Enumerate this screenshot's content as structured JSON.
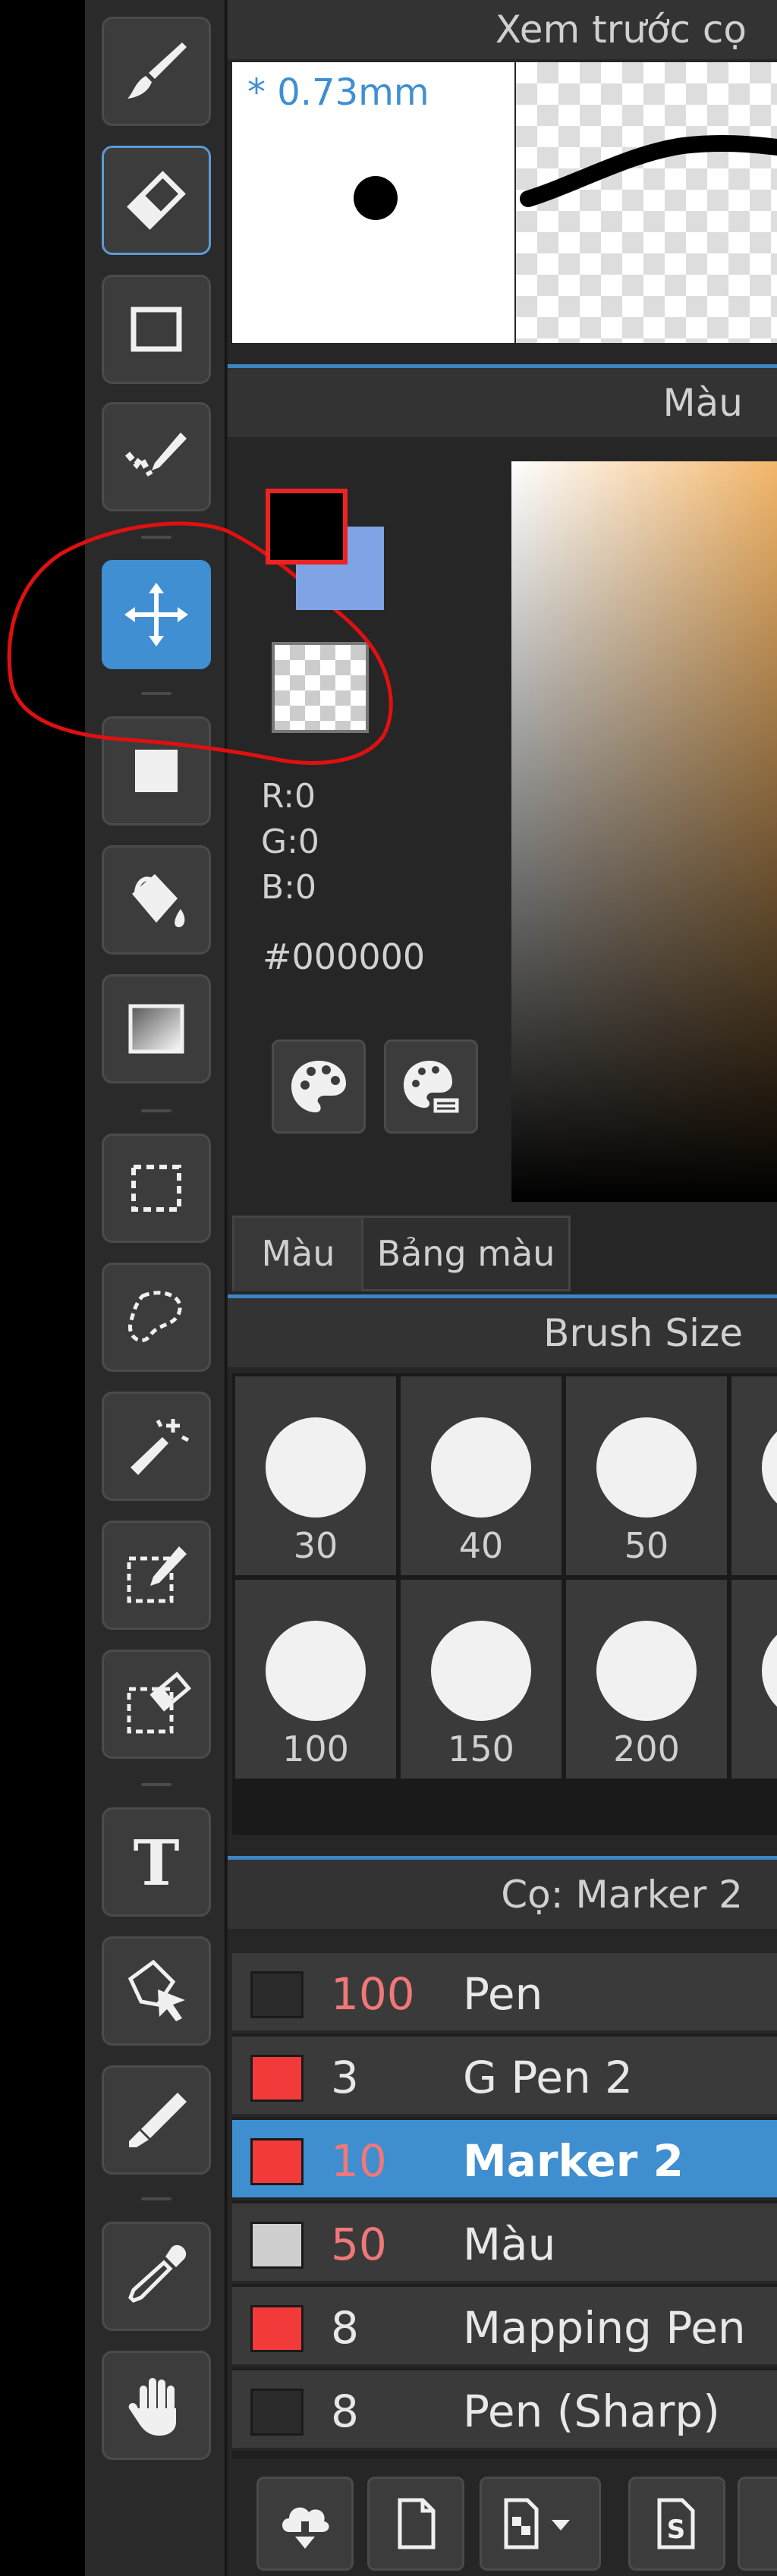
{
  "tools": [
    {
      "name": "brush-tool",
      "icon": "brush-icon"
    },
    {
      "name": "eraser-tool",
      "icon": "eraser-icon",
      "state": "outlined"
    },
    {
      "name": "shape-tool",
      "icon": "rectangle-icon"
    },
    {
      "name": "correction-tool",
      "icon": "check-pen-icon"
    },
    {
      "name": "move-tool",
      "icon": "move-arrows-icon",
      "state": "active"
    },
    {
      "name": "fill-rect-tool",
      "icon": "filled-square-icon"
    },
    {
      "name": "bucket-tool",
      "icon": "paint-bucket-icon"
    },
    {
      "name": "gradient-tool",
      "icon": "gradient-icon"
    },
    {
      "name": "rect-select-tool",
      "icon": "dashed-rectangle-icon"
    },
    {
      "name": "lasso-tool",
      "icon": "lasso-icon"
    },
    {
      "name": "magic-wand-tool",
      "icon": "magic-wand-icon"
    },
    {
      "name": "select-pen-tool",
      "icon": "select-pen-icon"
    },
    {
      "name": "select-eraser-tool",
      "icon": "select-eraser-icon"
    },
    {
      "name": "text-tool",
      "icon": "text-t-icon"
    },
    {
      "name": "operation-tool",
      "icon": "pointer-select-icon"
    },
    {
      "name": "divide-tool",
      "icon": "cutter-icon"
    },
    {
      "name": "eyedropper-tool",
      "icon": "eyedropper-icon"
    },
    {
      "name": "hand-tool",
      "icon": "hand-icon"
    }
  ],
  "brush_preview": {
    "title": "Xem trước cọ",
    "size_label": "* 0.73mm"
  },
  "color_panel": {
    "title": "Màu",
    "foreground": "#000000",
    "background": "#7fa4e6",
    "rgb": {
      "r": "R:0",
      "g": "G:0",
      "b": "B:0"
    },
    "hex": "#000000",
    "gradient_color": "#f3b66a"
  },
  "color_tabs": [
    {
      "label": "Màu",
      "active": true
    },
    {
      "label": "Bảng màu",
      "active": false
    }
  ],
  "brush_size": {
    "title": "Brush Size",
    "sizes": [
      "30",
      "40",
      "50",
      "100",
      "150",
      "200"
    ]
  },
  "brush_list": {
    "title": "Cọ: Marker 2",
    "items": [
      {
        "size": "100",
        "name": "Pen",
        "swatch": "#2a2a2a",
        "size_color": "#f07878"
      },
      {
        "size": "3",
        "name": "G Pen 2",
        "swatch": "#f23a3a",
        "size_color": "#e8e8e8"
      },
      {
        "size": "10",
        "name": "Marker 2",
        "swatch": "#f23a3a",
        "size_color": "#f07878",
        "selected": true
      },
      {
        "size": "50",
        "name": "Màu",
        "swatch": "#cfcfcf",
        "size_color": "#f07878"
      },
      {
        "size": "8",
        "name": "Mapping Pen",
        "swatch": "#f23a3a",
        "size_color": "#e8e8e8"
      },
      {
        "size": "8",
        "name": "Pen (Sharp)",
        "swatch": "#2a2a2a",
        "size_color": "#e8e8e8"
      }
    ]
  },
  "bottom_toolbar": [
    {
      "name": "cloud-download-button",
      "icon": "cloud-download-icon"
    },
    {
      "name": "new-brush-button",
      "icon": "new-file-icon"
    },
    {
      "name": "brush-type-dropdown",
      "icon": "dropdown-icon"
    },
    {
      "name": "save-brush-button",
      "icon": "s-file-icon"
    },
    {
      "name": "folder-button",
      "icon": "folder-icon"
    }
  ],
  "colors": {
    "accent": "#3f8fd2",
    "annotation": "#e01010"
  }
}
